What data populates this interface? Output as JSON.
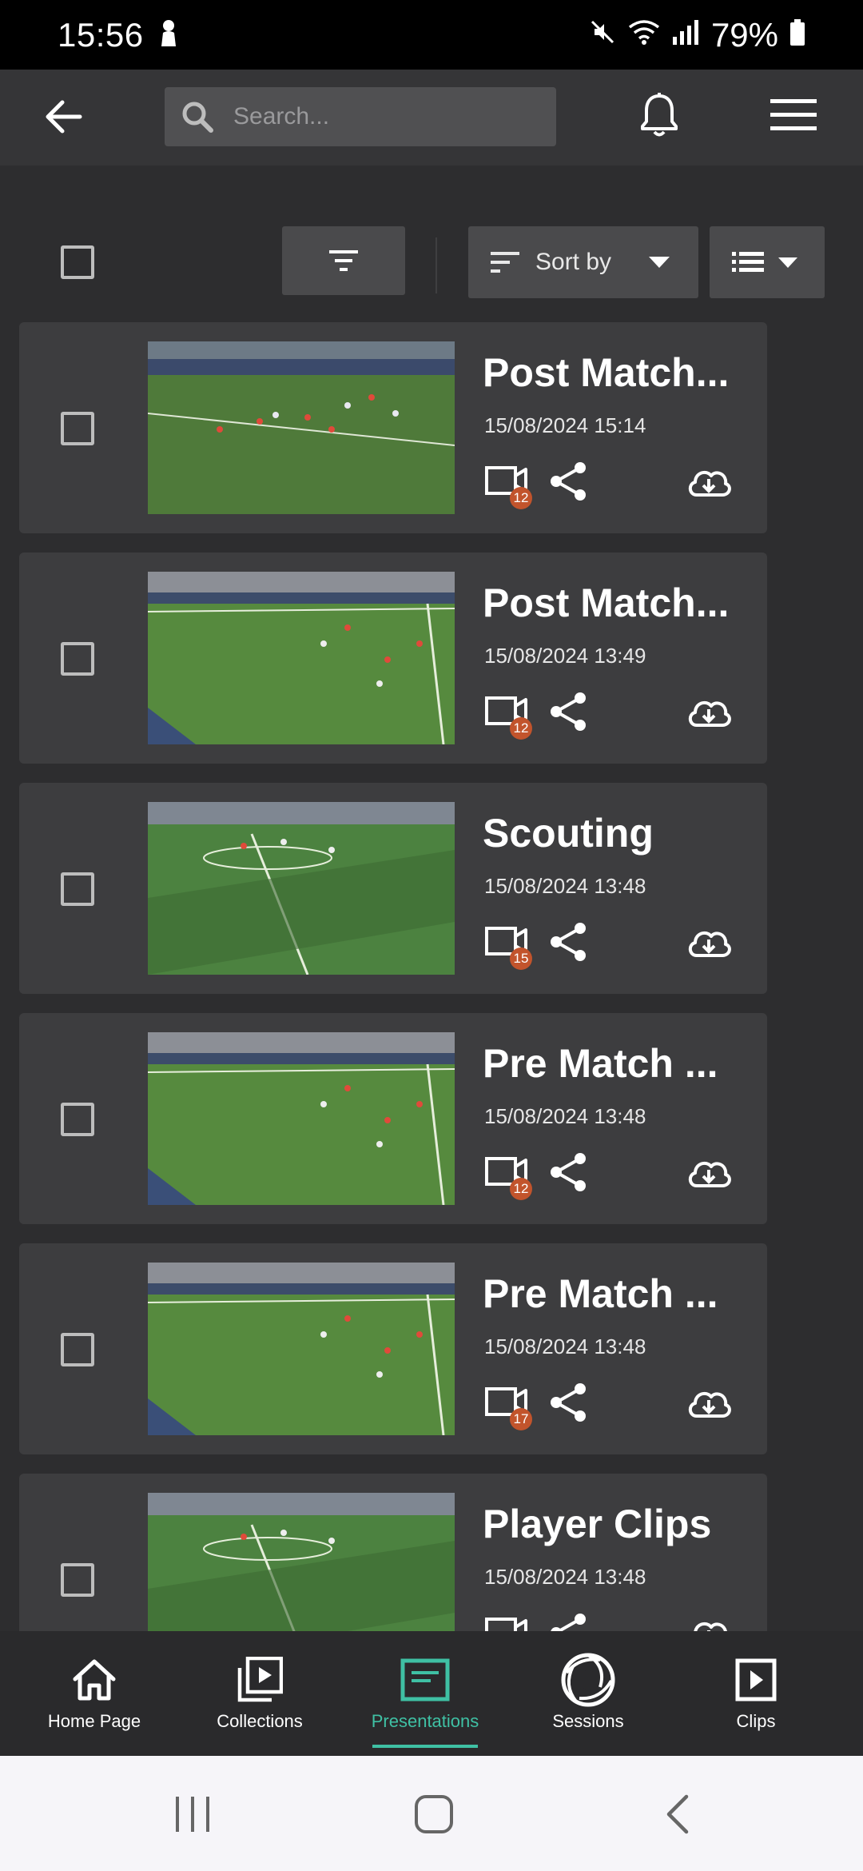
{
  "status_bar": {
    "time": "15:56",
    "battery": "79%",
    "icons": [
      "notification-person-icon",
      "mute-icon",
      "wifi-icon",
      "signal-icon",
      "battery-icon"
    ]
  },
  "header": {
    "search_placeholder": "Search...",
    "icons": [
      "back-arrow-icon",
      "search-icon",
      "bell-icon",
      "hamburger-menu-icon"
    ]
  },
  "toolbar": {
    "sort_label": "Sort by",
    "icons": [
      "filter-icon",
      "sort-icon",
      "caret-down-icon",
      "list-view-icon"
    ]
  },
  "presentations": [
    {
      "title": "Post Match...",
      "date": "15/08/2024 15:14",
      "clip_count": "12"
    },
    {
      "title": "Post Match...",
      "date": "15/08/2024 13:49",
      "clip_count": "12"
    },
    {
      "title": "Scouting",
      "date": "15/08/2024 13:48",
      "clip_count": "15"
    },
    {
      "title": "Pre Match ...",
      "date": "15/08/2024 13:48",
      "clip_count": "12"
    },
    {
      "title": "Pre Match ...",
      "date": "15/08/2024 13:48",
      "clip_count": "17"
    },
    {
      "title": "Player Clips",
      "date": "15/08/2024 13:48",
      "clip_count": ""
    }
  ],
  "bottom_nav": {
    "items": [
      {
        "label": "Home Page",
        "icon": "home-icon"
      },
      {
        "label": "Collections",
        "icon": "collections-icon"
      },
      {
        "label": "Presentations",
        "icon": "presentation-icon",
        "active": true
      },
      {
        "label": "Sessions",
        "icon": "sessions-aperture-icon"
      },
      {
        "label": "Clips",
        "icon": "clip-play-icon"
      }
    ],
    "active_color": "#3fc0a4"
  },
  "colors": {
    "background": "#2d2d2f",
    "card": "#3d3d3f",
    "badge": "#c2542c",
    "accent": "#3fc0a4"
  }
}
